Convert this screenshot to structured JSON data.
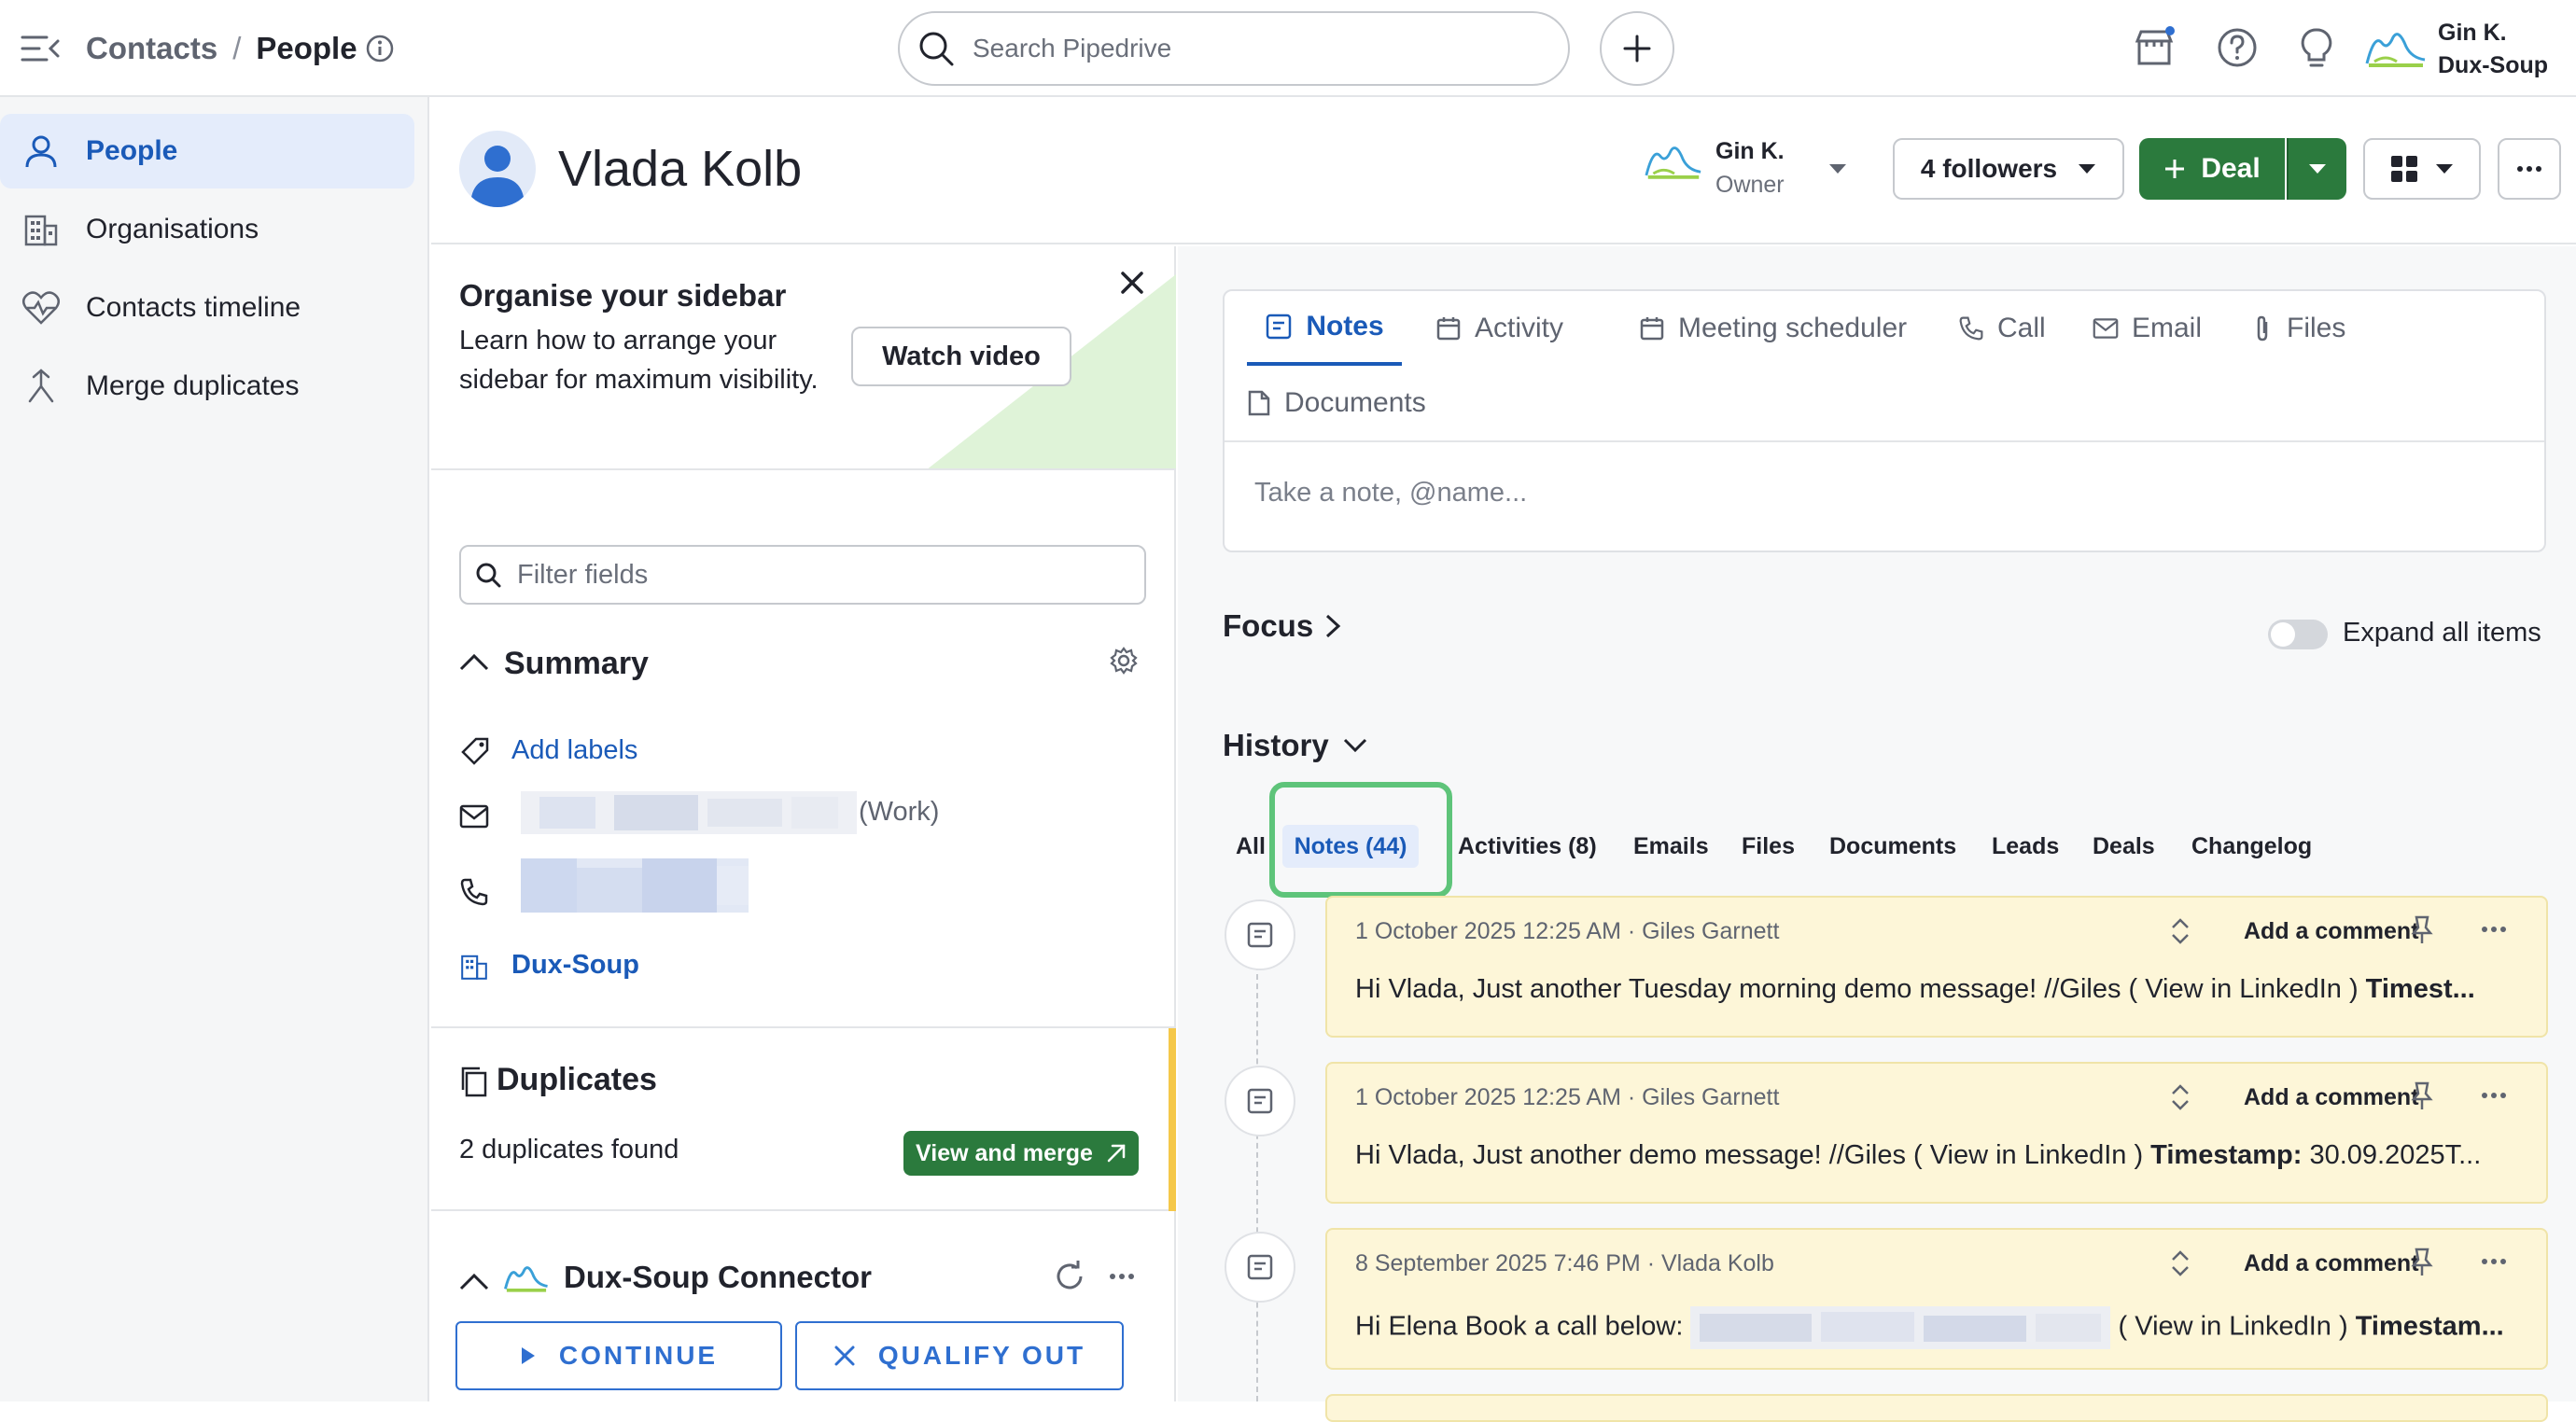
{
  "header": {
    "breadcrumb_parent": "Contacts",
    "breadcrumb_separator": "/",
    "breadcrumb_current": "People",
    "search_placeholder": "Search Pipedrive",
    "user_name": "Gin K.",
    "user_company": "Dux-Soup"
  },
  "nav": {
    "items": [
      {
        "label": "People",
        "icon": "person-icon",
        "active": true
      },
      {
        "label": "Organisations",
        "icon": "building-icon"
      },
      {
        "label": "Contacts timeline",
        "icon": "heart-pulse-icon"
      },
      {
        "label": "Merge duplicates",
        "icon": "merge-icon"
      }
    ]
  },
  "person": {
    "name": "Vlada Kolb",
    "owner_name": "Gin K.",
    "owner_role": "Owner",
    "followers_label": "4 followers",
    "deal_label": "Deal"
  },
  "sidebar": {
    "tip_title": "Organise your sidebar",
    "tip_body": "Learn how to arrange your sidebar for maximum visibility.",
    "watch_video": "Watch video",
    "filter_placeholder": "Filter fields",
    "summary_title": "Summary",
    "add_labels": "Add labels",
    "email_type": "(Work)",
    "organisation": "Dux-Soup",
    "duplicates_title": "Duplicates",
    "duplicates_found": "2 duplicates found",
    "view_and_merge": "View and merge",
    "connector_title": "Dux-Soup Connector",
    "continue_label": "CONTINUE",
    "qualify_out_label": "QUALIFY OUT"
  },
  "composer": {
    "tabs": [
      {
        "label": "Notes",
        "icon": "notes-icon",
        "active": true
      },
      {
        "label": "Activity",
        "icon": "calendar-icon"
      },
      {
        "label": "Meeting scheduler",
        "icon": "calendar-icon"
      },
      {
        "label": "Call",
        "icon": "phone-icon"
      },
      {
        "label": "Email",
        "icon": "mail-icon"
      },
      {
        "label": "Files",
        "icon": "paperclip-icon"
      },
      {
        "label": "Documents",
        "icon": "document-icon"
      }
    ],
    "note_placeholder": "Take a note, @name..."
  },
  "focus": {
    "label": "Focus",
    "expand_all_label": "Expand all items"
  },
  "history": {
    "label": "History",
    "tabs": [
      "All",
      "Notes (44)",
      "Activities (8)",
      "Emails",
      "Files",
      "Documents",
      "Leads",
      "Deals",
      "Changelog"
    ],
    "active_tab": "Notes (44)"
  },
  "notes": [
    {
      "meta": "1 October 2025 12:25 AM · Giles Garnett",
      "text": "Hi Vlada, Just another Tuesday morning demo message! //Giles ( View in LinkedIn ) ",
      "bold": "Timest..."
    },
    {
      "meta": "1 October 2025 12:25 AM · Giles Garnett",
      "text": "Hi Vlada, Just another demo message! //Giles ( View in LinkedIn ) ",
      "bold": "Timestamp:",
      "tail": " 30.09.2025T..."
    },
    {
      "meta": "8 September 2025 7:46 PM · Vlada Kolb",
      "text": "Hi Elena Book a call below: ",
      "text2": " ( View in LinkedIn ) ",
      "bold": "Timestam..."
    }
  ],
  "note_actions": {
    "comment_label": "Add a comment"
  },
  "colors": {
    "accent_blue": "#1a5ab8",
    "deal_green": "#2b7a3d",
    "note_bg": "#fdf6d8",
    "highlight_green": "#5ec47a",
    "duplicates_bar": "#f5c84a"
  }
}
